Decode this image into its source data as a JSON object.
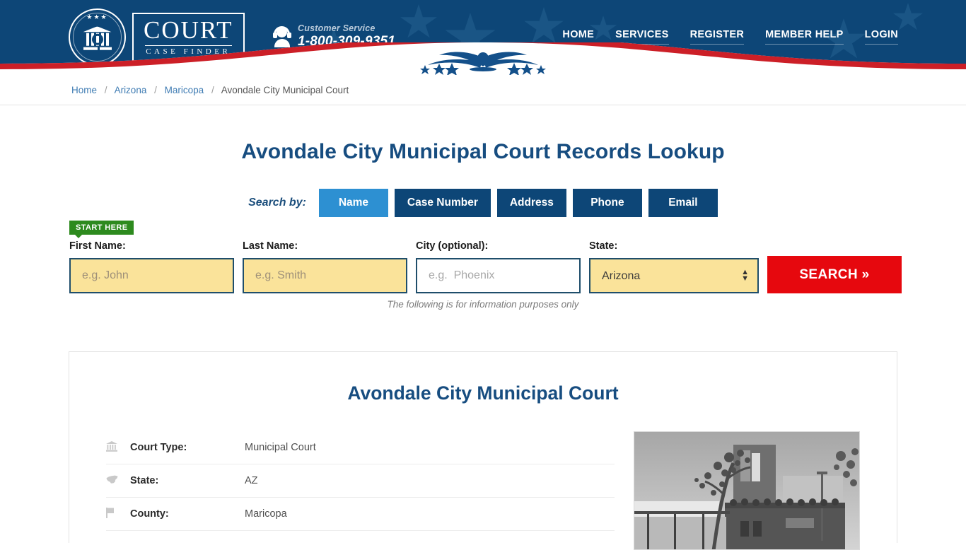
{
  "header": {
    "logo": {
      "main": "COURT",
      "sub": "CASE FINDER",
      "icon": "court-seal-icon"
    },
    "customer_service": {
      "label": "Customer Service",
      "phone": "1-800-309-9351",
      "icon": "headset-agent-icon"
    },
    "nav": [
      {
        "label": "HOME"
      },
      {
        "label": "SERVICES"
      },
      {
        "label": "REGISTER"
      },
      {
        "label": "MEMBER HELP"
      },
      {
        "label": "LOGIN"
      }
    ],
    "colors": {
      "navy": "#0d4677",
      "red": "#cc1f27",
      "white": "#ffffff"
    }
  },
  "breadcrumb": {
    "items": [
      {
        "label": "Home",
        "link": true
      },
      {
        "label": "Arizona",
        "link": true
      },
      {
        "label": "Maricopa",
        "link": true
      },
      {
        "label": "Avondale City Municipal Court",
        "link": false
      }
    ],
    "separator": "/"
  },
  "main": {
    "page_title": "Avondale City Municipal Court Records Lookup",
    "search_by_label": "Search by:",
    "tabs": [
      {
        "label": "Name",
        "active": true
      },
      {
        "label": "Case Number",
        "active": false
      },
      {
        "label": "Address",
        "active": false
      },
      {
        "label": "Phone",
        "active": false
      },
      {
        "label": "Email",
        "active": false
      }
    ],
    "start_here_badge": "START HERE",
    "form": {
      "first_name": {
        "label": "First Name:",
        "value": "",
        "placeholder": "e.g. John"
      },
      "last_name": {
        "label": "Last Name:",
        "value": "",
        "placeholder": "e.g. Smith"
      },
      "city": {
        "label": "City (optional):",
        "value": "",
        "placeholder": "e.g.  Phoenix"
      },
      "state": {
        "label": "State:",
        "value": "Arizona",
        "options": [
          "Arizona"
        ]
      },
      "search_button": "SEARCH »"
    },
    "disclaimer": "The following is for information purposes only"
  },
  "card": {
    "title": "Avondale City Municipal Court",
    "facts": [
      {
        "icon": "bank-building-icon",
        "glyph": "🏛",
        "key": "Court Type:",
        "value": "Municipal Court"
      },
      {
        "icon": "us-map-icon",
        "glyph": "◢",
        "key": "State:",
        "value": "AZ"
      },
      {
        "icon": "flag-icon",
        "glyph": "⚑",
        "key": "County:",
        "value": "Maricopa"
      }
    ],
    "photo_alt": "Avondale City Municipal Court building photo"
  }
}
